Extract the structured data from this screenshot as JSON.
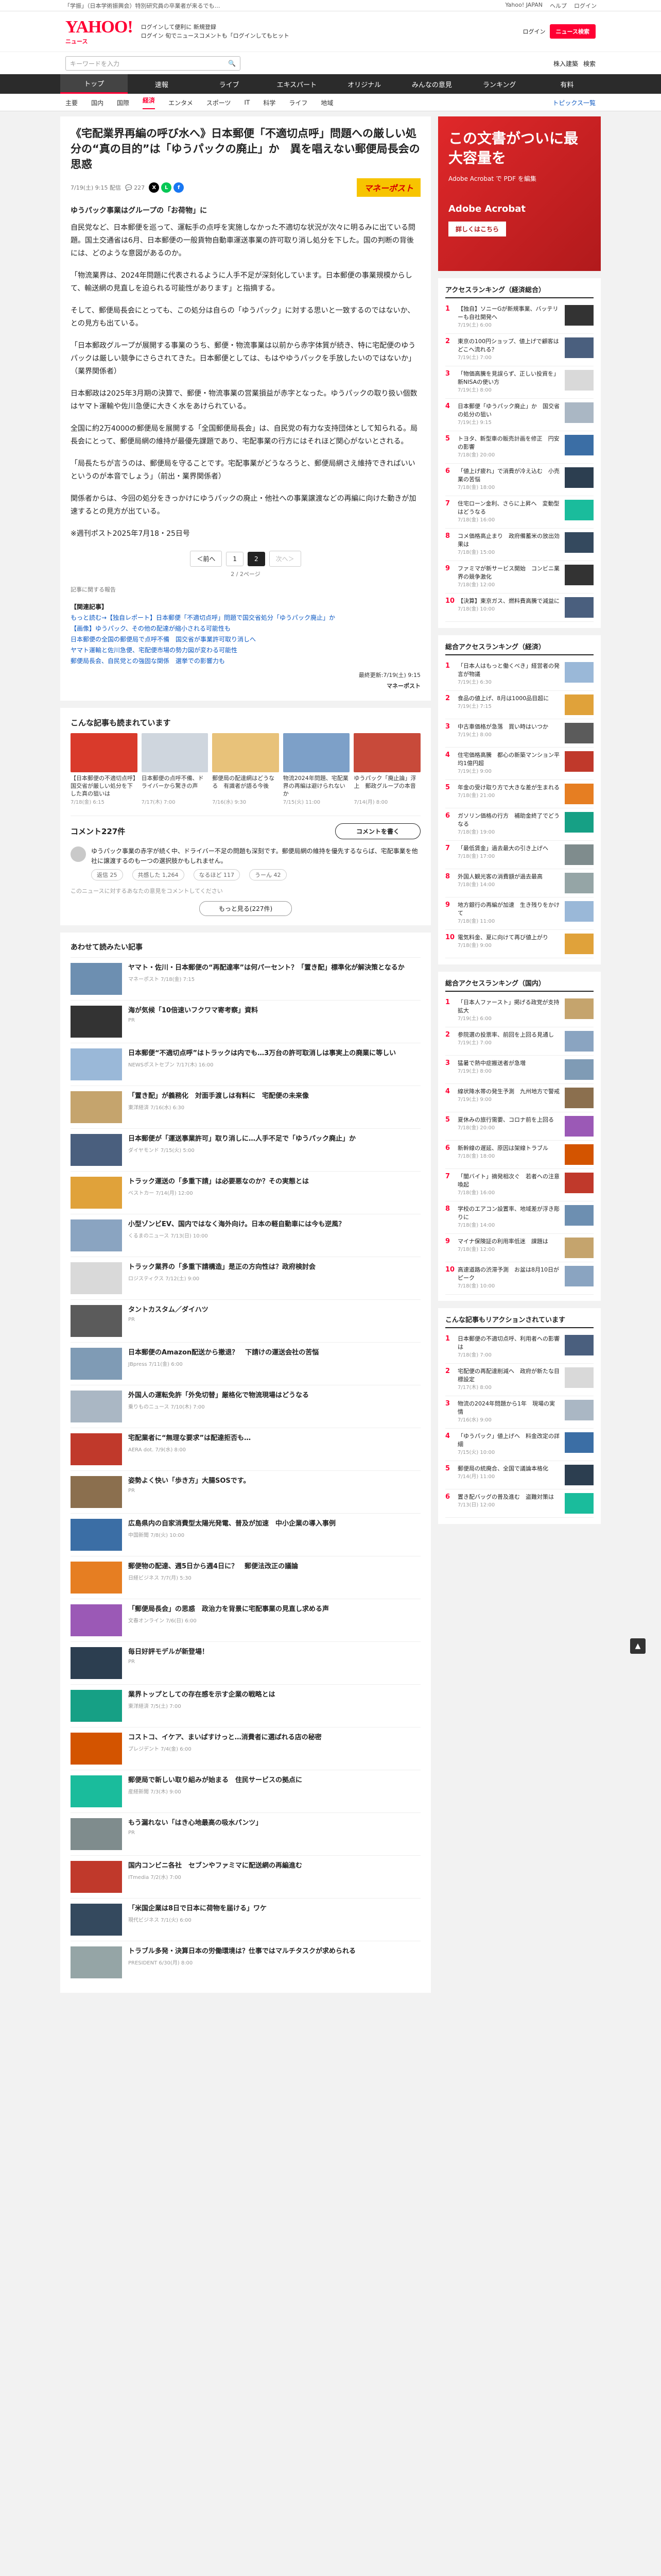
{
  "topbar": {
    "left": "「学振」（日本学術振興会）特別研究員の卒業者が来るでも…",
    "right_links": [
      "Yahoo! JAPAN",
      "ヘルプ",
      "ログイン"
    ]
  },
  "header": {
    "logo": "YAHOO!",
    "logo_sub": "ニュース",
    "links": [
      "ログインして便利に 新規登録",
      "ログイン 旬でニュースコメントも「ログインしてもヒット"
    ],
    "notice_label": "ログイン",
    "search_btn": "ニュース検索"
  },
  "search": {
    "placeholder": "キーワードを入力",
    "right": "株入建築",
    "right2": "検索"
  },
  "nav1": [
    "トップ",
    "速報",
    "ライブ",
    "エキスパート",
    "オリジナル",
    "みんなの意見",
    "ランキング",
    "有料"
  ],
  "nav1_active": 0,
  "nav2": [
    "主要",
    "国内",
    "国際",
    "経済",
    "エンタメ",
    "スポーツ",
    "IT",
    "科学",
    "ライフ",
    "地域"
  ],
  "nav2_active": 3,
  "nav2_more": "トピックス一覧",
  "article": {
    "title": "《宅配業界再編の呼び水へ》日本郵便「不適切点呼」問題への厳しい処分の“真の目的”は「ゆうパックの廃止」か　異を唱えない郵便局長会の思惑",
    "date": "7/19(土) 9:15 配信",
    "comments": "227",
    "brand": "マネーポスト",
    "lead": "ゆうパック事業はグループの「お荷物」に",
    "paragraphs": [
      "自民党など、日本郵便を巡って、運転手の点呼を実施しなかった不適切な状況が次々に明るみに出ている問題。国土交通省は6月、日本郵便の一般貨物自動車運送事業の許可取り消し処分を下した。国の判断の背後には、どのような意図があるのか。",
      "「物流業界は、2024年問題に代表されるように人手不足が深刻化しています。日本郵便の事業規模からして、輸送網の見直しを迫られる可能性があります」と指摘する。",
      "そして、郵便局長会にとっても、この処分は自らの「ゆうパック」に対する思いと一致するのではないか、との見方も出ている。",
      "「日本郵政グループが展開する事業のうち、郵便・物流事業は以前から赤字体質が続き、特に宅配便のゆうパックは厳しい競争にさらされてきた。日本郵便としては、もはやゆうパックを手放したいのではないか」（業界関係者）",
      "日本郵政は2025年3月期の決算で、郵便・物流事業の営業損益が赤字となった。ゆうパックの取り扱い個数はヤマト運輸や佐川急便に大きく水をあけられている。",
      "全国に約2万4000の郵便局を展開する「全国郵便局長会」は、自民党の有力な支持団体として知られる。局長会にとって、郵便局網の維持が最優先課題であり、宅配事業の行方にはそれほど関心がないとされる。",
      "「局長たちが言うのは、郵便局を守ることです。宅配事業がどうなろうと、郵便局網さえ維持できればいいというのが本音でしょう」（前出・業界関係者）",
      "関係者からは、今回の処分をきっかけにゆうパックの廃止・他社への事業譲渡などの再編に向けた動きが加速するとの見方が出ている。",
      "※週刊ポスト2025年7月18・25日号"
    ],
    "pager": [
      "＜前へ",
      "1",
      "2",
      "次へ＞"
    ],
    "pager_current": 1,
    "pagecount": "2 / 2ページ",
    "report_link": "記事に関する報告",
    "related_head": "【関連記事】",
    "related": [
      "もっと読む→【独自レポート】日本郵便「不適切点呼」問題で国交省処分「ゆうパック廃止」か",
      "【画像】ゆうパック、その他の配達が縮小される可能性も",
      "日本郵便の全国の郵便局で点呼不備　国交省が事業許可取り消しへ",
      "ヤマト運輸と佐川急便、宅配便市場の勢力図が変わる可能性",
      "郵便局長会、自民党との強固な関係　選挙での影響力も"
    ],
    "source": "最終更新:7/19(土) 9:15",
    "source_brand": "マネーポスト"
  },
  "pickup": {
    "title": "こんな記事も読まれています",
    "items": [
      {
        "cap": "【日本郵便の不適切点呼】国交省が厳しい処分を下した真の狙いは",
        "date": "7/18(金) 6:15"
      },
      {
        "cap": "日本郵便の点呼不備、ドライバーから驚きの声",
        "date": "7/17(木) 7:00"
      },
      {
        "cap": "郵便局の配達網はどうなる　有識者が語る今後",
        "date": "7/16(水) 9:30"
      },
      {
        "cap": "物流2024年問題、宅配業界の再編は避けられないか",
        "date": "7/15(火) 11:00"
      },
      {
        "cap": "ゆうパック「廃止論」浮上　郵政グループの本音",
        "date": "7/14(月) 8:00"
      }
    ]
  },
  "comments": {
    "count_label": "コメント227件",
    "write_btn": "コメントを書く",
    "top": {
      "text": "ゆうパック事業の赤字が続く中、ドライバー不足の問題も深刻です。郵便局網の維持を優先するならば、宅配事業を他社に譲渡するのも一つの選択肢かもしれません。",
      "acts": [
        "返信 25",
        "共感した 1,264",
        "なるほど 117",
        "うーん 42"
      ]
    },
    "more": "もっと見る(227件)",
    "notice": "このニュースに対するあなたの意見をコメントしてください"
  },
  "recs": {
    "title": "あわせて読みたい記事",
    "items": [
      {
        "t": "ヤマト・佐川・日本郵便の“再配達率”は何パーセント？「置き配」標準化が解決策となるか",
        "s": "マネーポスト 7/18(金) 7:15"
      },
      {
        "t": "海が気候「10倍速いフクワマ寄考察」資料",
        "s": "PR"
      },
      {
        "t": "日本郵便“不適切点呼”はトラックは内でも…3万台の許可取消しは事実上の廃業に等しい",
        "s": "NEWSポストセブン 7/17(木) 16:00"
      },
      {
        "t": "「置き配」が義務化　対面手渡しは有料に　宅配便の未来像",
        "s": "東洋経済 7/16(水) 6:30"
      },
      {
        "t": "日本郵便が「運送事業許可」取り消しに…人手不足で「ゆうパック廃止」か",
        "s": "ダイヤモンド 7/15(火) 5:00"
      },
      {
        "t": "トラック運送の「多重下請」は必要悪なのか？その実態とは",
        "s": "ベストカー 7/14(月) 12:00"
      },
      {
        "t": "小型ゾンビEV、国内ではなく海外向け。日本の軽自動車には今も逆風？",
        "s": "くるまのニュース 7/13(日) 10:00"
      },
      {
        "t": "トラック業界の「多重下請構造」是正の方向性は？政府検討会",
        "s": "ロジスティクス 7/12(土) 9:00"
      },
      {
        "t": "タントカスタム／ダイハツ",
        "s": "PR"
      },
      {
        "t": "日本郵便のAmazon配送から撤退？　下請けの運送会社の苦悩",
        "s": "JBpress 7/11(金) 6:00"
      },
      {
        "t": "外国人の運転免許「外免切替」厳格化で物流現場はどうなる",
        "s": "乗りものニュース 7/10(木) 7:00"
      },
      {
        "t": "宅配業者に“無理な要求”は配達拒否も…",
        "s": "AERA dot. 7/9(水) 8:00"
      },
      {
        "t": "姿勢よく快い「歩き方」大腸SOSです。",
        "s": "PR"
      },
      {
        "t": "広島県内の自家消費型太陽光発電、普及が加速　中小企業の導入事例",
        "s": "中国新聞 7/8(火) 10:00"
      },
      {
        "t": "郵便物の配達、週5日から週4日に？　郵便法改正の議論",
        "s": "日経ビジネス 7/7(月) 5:30"
      },
      {
        "t": "「郵便局長会」の思惑　政治力を背景に宅配事業の見直し求める声",
        "s": "文春オンライン 7/6(日) 6:00"
      },
      {
        "t": "毎日好評モデルが新登場！",
        "s": "PR"
      },
      {
        "t": "業界トップとしての存在感を示す企業の戦略とは",
        "s": "東洋経済 7/5(土) 7:00"
      },
      {
        "t": "コストコ、イケア、まいばすけっと…消費者に選ばれる店の秘密",
        "s": "プレジデント 7/4(金) 6:00"
      },
      {
        "t": "郵便局で新しい取り組みが始まる　住民サービスの拠点に",
        "s": "産経新聞 7/3(木) 9:00"
      },
      {
        "t": "もう漏れない「はき心地最高の吸水パンツ」",
        "s": "PR"
      },
      {
        "t": "国内コンビニ各社　セブンやファミマに配送網の再編進む",
        "s": "ITmedia 7/2(水) 7:00"
      },
      {
        "t": "「米国企業は8日で日本に荷物を届ける」ワケ",
        "s": "現代ビジネス 7/1(火) 6:00"
      },
      {
        "t": "トラブル多発・決算日本の労働環境は？仕事ではマルチタスクが求められる",
        "s": "PRESIDENT 6/30(月) 8:00"
      }
    ]
  },
  "ad": {
    "big": "この文書がついに最大容量を",
    "sm": "Adobe Acrobat で PDF を編集",
    "lg": "Adobe Acrobat",
    "cta": "詳しくはこちら"
  },
  "side_ranking1": {
    "title": "アクセスランキング（経済総合）",
    "items": [
      {
        "t": "【独自】ソニーGが新規事業、バッテリーも自社開発へ",
        "d": "7/19(土) 6:00"
      },
      {
        "t": "東京の100円ショップ、値上げで顧客はどこへ流れる？",
        "d": "7/19(土) 7:00"
      },
      {
        "t": "「物価高騰を見誤らず、正しい投資を」新NISAの使い方",
        "d": "7/19(土) 8:00"
      },
      {
        "t": "日本郵便「ゆうパック廃止」か　国交省の処分の狙い",
        "d": "7/19(土) 9:15"
      },
      {
        "t": "トヨタ、新型車の販売計画を修正　円安の影響",
        "d": "7/18(金) 20:00"
      },
      {
        "t": "「値上げ疲れ」で消費が冷え込む　小売業の苦悩",
        "d": "7/18(金) 18:00"
      },
      {
        "t": "住宅ローン金利、さらに上昇へ　変動型はどうなる",
        "d": "7/18(金) 16:00"
      },
      {
        "t": "コメ価格高止まり　政府備蓄米の放出効果は",
        "d": "7/18(金) 15:00"
      },
      {
        "t": "ファミマが新サービス開始　コンビニ業界の競争激化",
        "d": "7/18(金) 12:00"
      },
      {
        "t": "【決算】東京ガス、燃料費高騰で減益に",
        "d": "7/18(金) 10:00"
      }
    ]
  },
  "side_ranking2": {
    "title": "総合アクセスランキング（経済）",
    "items": [
      {
        "t": "「日本人はもっと働くべき」経営者の発言が物議",
        "d": "7/19(土) 6:30"
      },
      {
        "t": "食品の値上げ、8月は1000品目超に",
        "d": "7/19(土) 7:15"
      },
      {
        "t": "中古車価格が急落　買い時はいつか",
        "d": "7/19(土) 8:00"
      },
      {
        "t": "住宅価格高騰　都心の新築マンション平均1億円超",
        "d": "7/19(土) 9:00"
      },
      {
        "t": "年金の受け取り方で大きな差が生まれる",
        "d": "7/18(金) 21:00"
      },
      {
        "t": "ガソリン価格の行方　補助金終了でどうなる",
        "d": "7/18(金) 19:00"
      },
      {
        "t": "「最低賃金」過去最大の引き上げへ",
        "d": "7/18(金) 17:00"
      },
      {
        "t": "外国人観光客の消費額が過去最高",
        "d": "7/18(金) 14:00"
      },
      {
        "t": "地方銀行の再編が加速　生き残りをかけて",
        "d": "7/18(金) 11:00"
      },
      {
        "t": "電気料金、夏に向けて再び値上がり",
        "d": "7/18(金) 9:00"
      }
    ]
  },
  "side_ranking3": {
    "title": "総合アクセスランキング（国内）",
    "items": [
      {
        "t": "「日本人ファースト」掲げる政党が支持拡大",
        "d": "7/19(土) 6:00"
      },
      {
        "t": "参院選の投票率、前回を上回る見通し",
        "d": "7/19(土) 7:00"
      },
      {
        "t": "猛暑で熱中症搬送者が急増",
        "d": "7/19(土) 8:00"
      },
      {
        "t": "線状降水帯の発生予測　九州地方で警戒",
        "d": "7/19(土) 9:00"
      },
      {
        "t": "夏休みの旅行需要、コロナ前を上回る",
        "d": "7/18(金) 20:00"
      },
      {
        "t": "新幹線の遅延、原因は架線トラブル",
        "d": "7/18(金) 18:00"
      },
      {
        "t": "「闇バイト」摘発相次ぐ　若者への注意喚起",
        "d": "7/18(金) 16:00"
      },
      {
        "t": "学校のエアコン設置率、地域差が浮き彫りに",
        "d": "7/18(金) 14:00"
      },
      {
        "t": "マイナ保険証の利用率低迷　課題は",
        "d": "7/18(金) 12:00"
      },
      {
        "t": "高速道路の渋滞予測　お盆は8月10日がピーク",
        "d": "7/18(金) 10:00"
      }
    ]
  },
  "side_ranking4": {
    "title": "こんな記事もリアクションされています",
    "items": [
      {
        "t": "日本郵便の不適切点呼、利用者への影響は",
        "d": "7/18(金) 7:00"
      },
      {
        "t": "宅配便の再配達削減へ　政府が新たな目標設定",
        "d": "7/17(木) 8:00"
      },
      {
        "t": "物流の2024年問題から1年　現場の実情",
        "d": "7/16(水) 9:00"
      },
      {
        "t": "「ゆうパック」値上げへ　料金改定の詳細",
        "d": "7/15(火) 10:00"
      },
      {
        "t": "郵便局の統廃合、全国で議論本格化",
        "d": "7/14(月) 11:00"
      },
      {
        "t": "置き配バッグの普及進む　盗難対策は",
        "d": "7/13(日) 12:00"
      }
    ]
  },
  "colors": {
    "brand_red": "#ff0033",
    "nav_dark": "#2b2b2b",
    "link_blue": "#0a57c2"
  }
}
